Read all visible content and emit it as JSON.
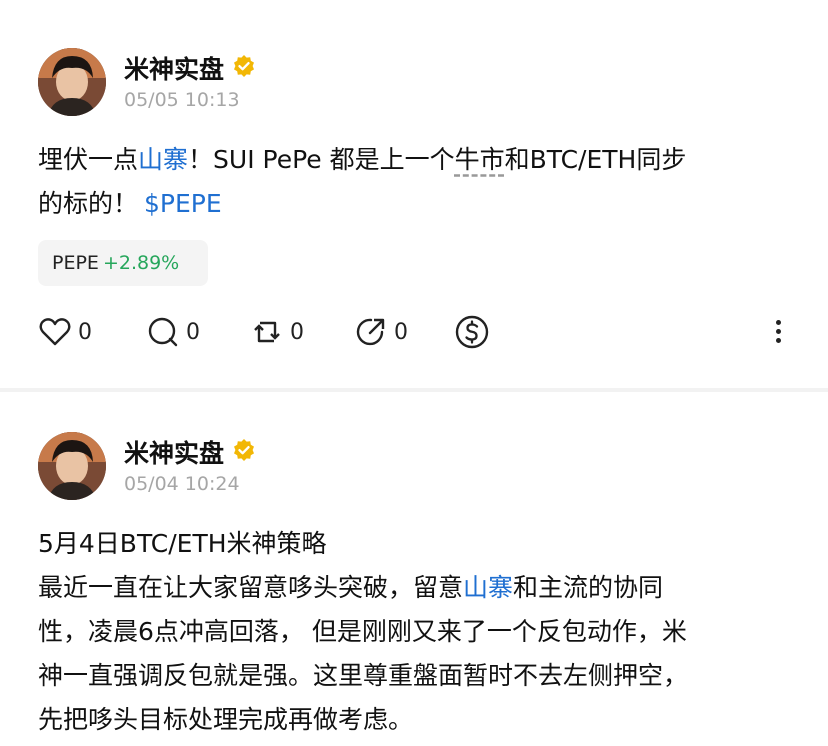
{
  "posts": [
    {
      "username": "米神实盘",
      "time": "05/05 10:13",
      "body": {
        "p1": "埋伏一点",
        "link1": "山寨",
        "p2": "！SUI PePe 都是上一个",
        "term": "牛市",
        "p3": "和BTC/ETH同步",
        "p4": "的标的！",
        "cashtag": "$PEPE"
      },
      "ticker": {
        "symbol": "PEPE",
        "change": "+2.89%"
      },
      "actions": {
        "likes": "0",
        "comments": "0",
        "reposts": "0",
        "shares": "0"
      }
    },
    {
      "username": "米神实盘",
      "time": "05/04 10:24",
      "body": {
        "line1": "5月4日BTC/ETH米神策略",
        "p1": "最近一直在让大家留意哆头突破，留意",
        "link1": "山寨",
        "p2": "和主流的协同",
        "line3": "性，凌晨6点冲高回落， 但是刚刚又来了一个反包动作，米",
        "line4": "神一直强调反包就是强。这里尊重盤面暂时不去左侧押空，",
        "line5": "先把哆头目标处理完成再做考虑。"
      }
    }
  ],
  "colors": {
    "link": "#1f6fd1",
    "up": "#26a65b",
    "badge": "#f2b705",
    "time": "#a6a6a6"
  },
  "icons": [
    "heart-icon",
    "comment-icon",
    "repost-icon",
    "share-icon",
    "dollar-icon",
    "more-icon",
    "verified-badge-icon"
  ]
}
